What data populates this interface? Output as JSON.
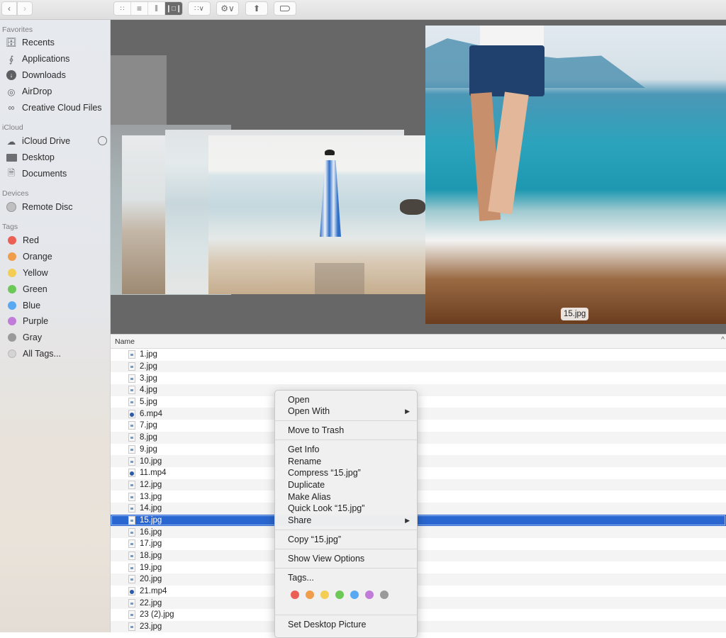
{
  "toolbar": {
    "back_icon": "chevron-left-icon",
    "forward_icon": "chevron-right-icon",
    "view_modes": [
      "icon-view",
      "list-view",
      "column-view",
      "cover-flow-view"
    ],
    "active_view": "cover-flow-view",
    "group_icon": "group-by-icon",
    "action_icon": "gear-icon",
    "share_icon": "share-icon",
    "tag_icon": "tag-icon"
  },
  "sidebar": {
    "favorites_header": "Favorites",
    "favorites": [
      {
        "label": "Recents",
        "icon": "recents-icon"
      },
      {
        "label": "Applications",
        "icon": "applications-icon"
      },
      {
        "label": "Downloads",
        "icon": "downloads-icon"
      },
      {
        "label": "AirDrop",
        "icon": "airdrop-icon"
      },
      {
        "label": "Creative Cloud Files",
        "icon": "creative-cloud-icon"
      }
    ],
    "icloud_header": "iCloud",
    "icloud": [
      {
        "label": "iCloud Drive",
        "icon": "cloud-icon"
      },
      {
        "label": "Desktop",
        "icon": "desktop-icon"
      },
      {
        "label": "Documents",
        "icon": "documents-icon"
      }
    ],
    "devices_header": "Devices",
    "devices": [
      {
        "label": "Remote Disc",
        "icon": "disc-icon"
      }
    ],
    "tags_header": "Tags",
    "tags": [
      {
        "label": "Red",
        "color": "#ec5f55"
      },
      {
        "label": "Orange",
        "color": "#f09d4c"
      },
      {
        "label": "Yellow",
        "color": "#f4cd55"
      },
      {
        "label": "Green",
        "color": "#6dc957"
      },
      {
        "label": "Blue",
        "color": "#58a9f2"
      },
      {
        "label": "Purple",
        "color": "#c17bd8"
      },
      {
        "label": "Gray",
        "color": "#9a9a9a"
      },
      {
        "label": "All Tags...",
        "color": "#d4d4d4"
      }
    ]
  },
  "coverflow": {
    "caption": "15.jpg"
  },
  "list": {
    "column_name": "Name",
    "sort_indicator": "^",
    "selected_index": 14,
    "files": [
      {
        "name": "1.jpg",
        "type": "image"
      },
      {
        "name": "2.jpg",
        "type": "image"
      },
      {
        "name": "3.jpg",
        "type": "image"
      },
      {
        "name": "4.jpg",
        "type": "image"
      },
      {
        "name": "5.jpg",
        "type": "image"
      },
      {
        "name": "6.mp4",
        "type": "video"
      },
      {
        "name": "7.jpg",
        "type": "image"
      },
      {
        "name": "8.jpg",
        "type": "image"
      },
      {
        "name": "9.jpg",
        "type": "image"
      },
      {
        "name": "10.jpg",
        "type": "image"
      },
      {
        "name": "11.mp4",
        "type": "video"
      },
      {
        "name": "12.jpg",
        "type": "image"
      },
      {
        "name": "13.jpg",
        "type": "image"
      },
      {
        "name": "14.jpg",
        "type": "image"
      },
      {
        "name": "15.jpg",
        "type": "image"
      },
      {
        "name": "16.jpg",
        "type": "image"
      },
      {
        "name": "17.jpg",
        "type": "image"
      },
      {
        "name": "18.jpg",
        "type": "image"
      },
      {
        "name": "19.jpg",
        "type": "image"
      },
      {
        "name": "20.jpg",
        "type": "image"
      },
      {
        "name": "21.mp4",
        "type": "video"
      },
      {
        "name": "22.jpg",
        "type": "image"
      },
      {
        "name": "23 (2).jpg",
        "type": "image"
      },
      {
        "name": "23.jpg",
        "type": "image"
      }
    ]
  },
  "context_menu": {
    "open": "Open",
    "open_with": "Open With",
    "move_to_trash": "Move to Trash",
    "get_info": "Get Info",
    "rename": "Rename",
    "compress": "Compress “15.jpg”",
    "duplicate": "Duplicate",
    "make_alias": "Make Alias",
    "quick_look": "Quick Look “15.jpg”",
    "share": "Share",
    "copy": "Copy “15.jpg”",
    "show_view_options": "Show View Options",
    "tags": "Tags...",
    "tag_colors": [
      "#ec5f55",
      "#f09d4c",
      "#f4cd55",
      "#6dc957",
      "#58a9f2",
      "#c17bd8",
      "#9a9a9a"
    ],
    "set_desktop_picture": "Set Desktop Picture",
    "submenu_arrow": "▶"
  }
}
